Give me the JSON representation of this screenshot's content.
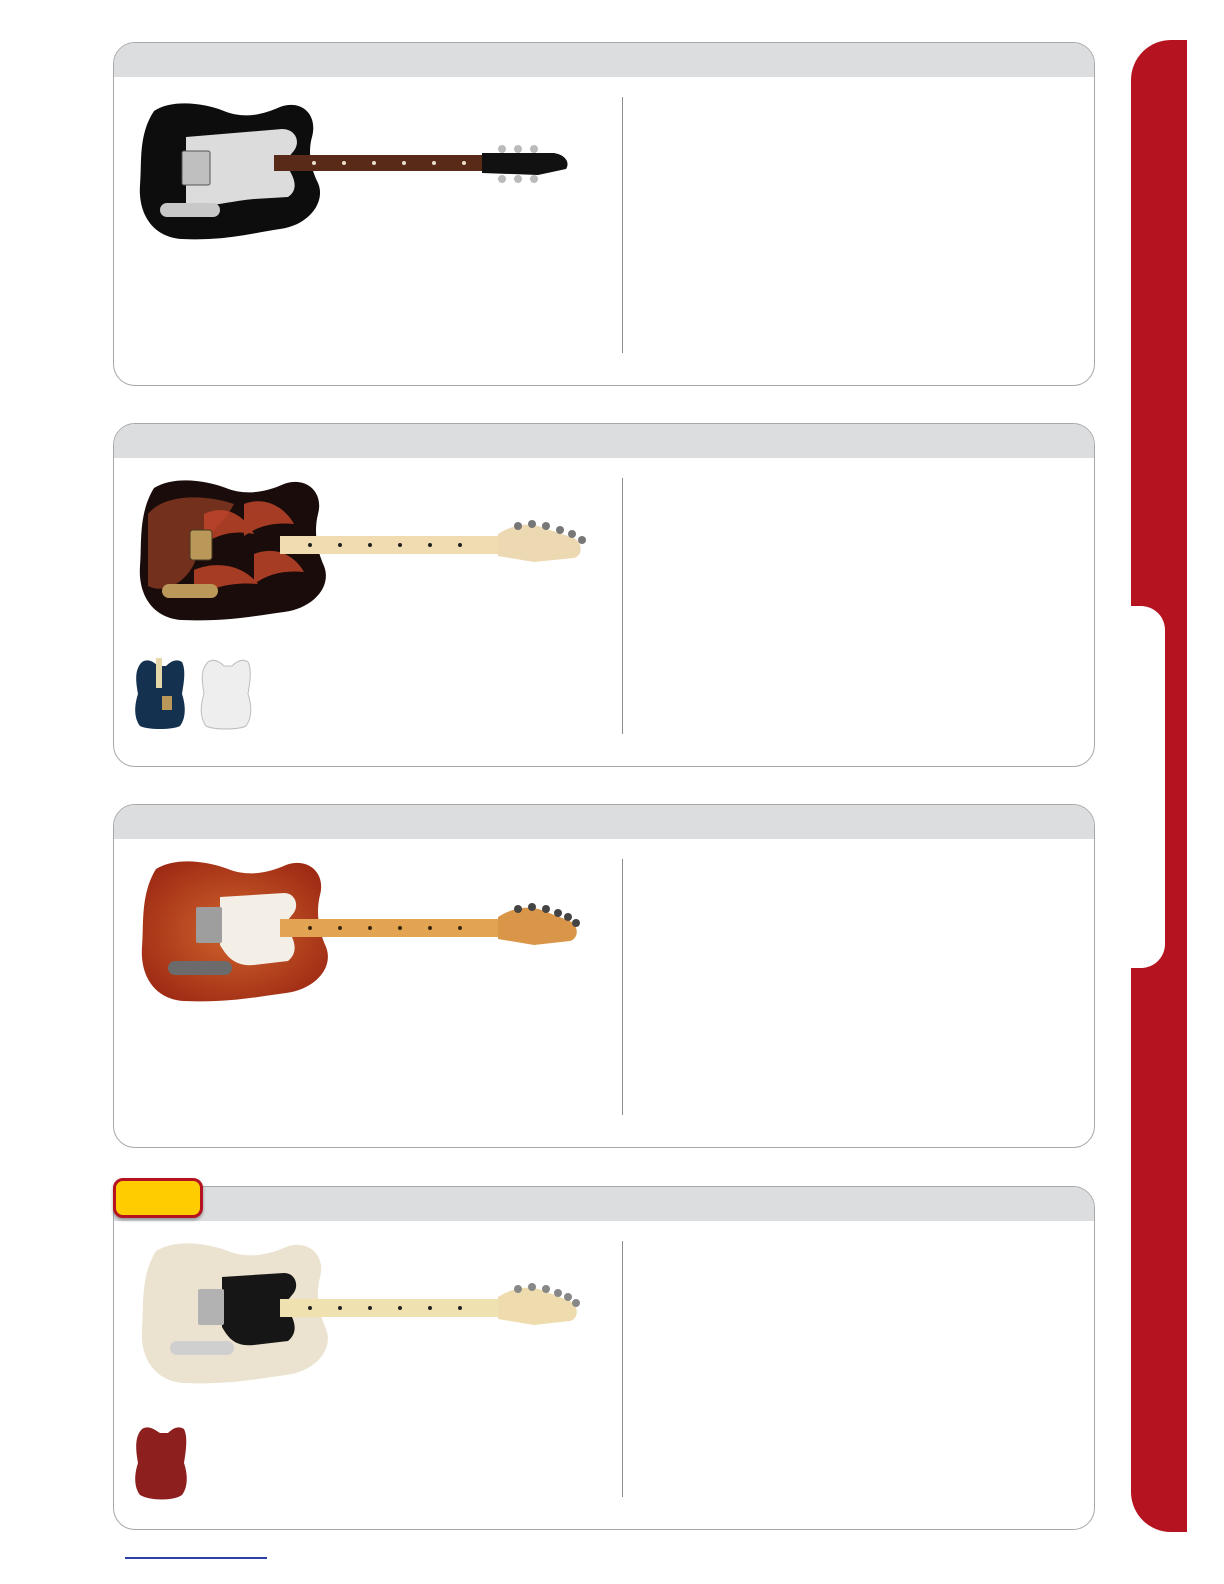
{
  "page": {
    "colors": {
      "accent_red": "#b5131f",
      "badge_yellow": "#ffcc00",
      "header_gray": "#dcdddf",
      "footer_link_blue": "#2b3fa8"
    }
  },
  "sections": [
    {
      "guitar": {
        "finish": "black",
        "fretboard": "rosewood",
        "pickguard": "white"
      },
      "color_options": []
    },
    {
      "guitar": {
        "finish": "black-red-paisley-flames",
        "fretboard": "maple"
      },
      "color_options": [
        "blue-paisley",
        "white"
      ]
    },
    {
      "guitar": {
        "finish": "cherry-red-burst",
        "fretboard": "maple",
        "pickguard": "white"
      },
      "color_options": []
    },
    {
      "guitar": {
        "finish": "blonde",
        "fretboard": "maple",
        "pickguard": "black"
      },
      "color_options": [
        "dark-red"
      ],
      "badge": "new-badge"
    }
  ]
}
